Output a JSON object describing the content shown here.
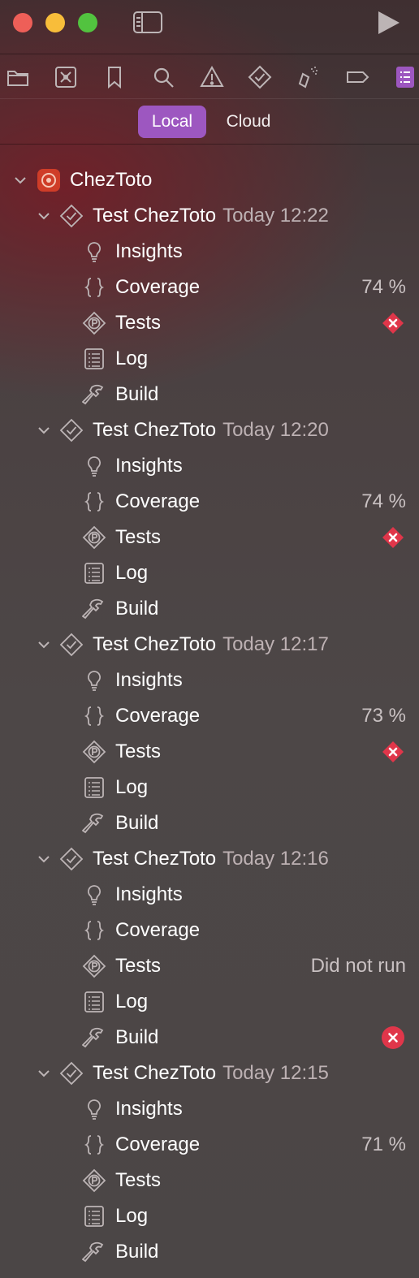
{
  "colors": {
    "accent": "#9d57c0",
    "error": "#e0364a",
    "traffic_close": "#ee5f58",
    "traffic_minimize": "#f8bd3a",
    "traffic_zoom": "#52c33f"
  },
  "titlebar": {
    "icons": [
      "close-button",
      "minimize-button",
      "zoom-button",
      "sidebar-toggle-icon",
      "run-icon"
    ]
  },
  "toolbar": {
    "icons": [
      "folder-icon",
      "source-control-icon",
      "bookmark-icon",
      "search-icon",
      "warning-icon",
      "test-icon",
      "debug-icon",
      "breakpoint-icon",
      "report-icon"
    ],
    "selected": "report-icon"
  },
  "segments": {
    "local": "Local",
    "cloud": "Cloud",
    "selected": "Local"
  },
  "project": {
    "name": "ChezToto"
  },
  "runs": [
    {
      "title": "Test ChezToto",
      "time": "Today 12:22",
      "items": [
        {
          "label": "Insights",
          "icon": "lightbulb-icon",
          "value": ""
        },
        {
          "label": "Coverage",
          "icon": "braces-icon",
          "value": "74 %"
        },
        {
          "label": "Tests",
          "icon": "test-plan-icon",
          "value": "",
          "status": "failed"
        },
        {
          "label": "Log",
          "icon": "log-icon",
          "value": ""
        },
        {
          "label": "Build",
          "icon": "hammer-icon",
          "value": ""
        }
      ]
    },
    {
      "title": "Test ChezToto",
      "time": "Today 12:20",
      "items": [
        {
          "label": "Insights",
          "icon": "lightbulb-icon",
          "value": ""
        },
        {
          "label": "Coverage",
          "icon": "braces-icon",
          "value": "74 %"
        },
        {
          "label": "Tests",
          "icon": "test-plan-icon",
          "value": "",
          "status": "failed"
        },
        {
          "label": "Log",
          "icon": "log-icon",
          "value": ""
        },
        {
          "label": "Build",
          "icon": "hammer-icon",
          "value": ""
        }
      ]
    },
    {
      "title": "Test ChezToto",
      "time": "Today 12:17",
      "items": [
        {
          "label": "Insights",
          "icon": "lightbulb-icon",
          "value": ""
        },
        {
          "label": "Coverage",
          "icon": "braces-icon",
          "value": "73 %"
        },
        {
          "label": "Tests",
          "icon": "test-plan-icon",
          "value": "",
          "status": "failed"
        },
        {
          "label": "Log",
          "icon": "log-icon",
          "value": ""
        },
        {
          "label": "Build",
          "icon": "hammer-icon",
          "value": ""
        }
      ]
    },
    {
      "title": "Test ChezToto",
      "time": "Today 12:16",
      "items": [
        {
          "label": "Insights",
          "icon": "lightbulb-icon",
          "value": ""
        },
        {
          "label": "Coverage",
          "icon": "braces-icon",
          "value": ""
        },
        {
          "label": "Tests",
          "icon": "test-plan-icon",
          "value": "Did not run"
        },
        {
          "label": "Log",
          "icon": "log-icon",
          "value": ""
        },
        {
          "label": "Build",
          "icon": "hammer-icon",
          "value": "",
          "status": "error"
        }
      ]
    },
    {
      "title": "Test ChezToto",
      "time": "Today 12:15",
      "items": [
        {
          "label": "Insights",
          "icon": "lightbulb-icon",
          "value": ""
        },
        {
          "label": "Coverage",
          "icon": "braces-icon",
          "value": "71 %"
        },
        {
          "label": "Tests",
          "icon": "test-plan-icon",
          "value": ""
        },
        {
          "label": "Log",
          "icon": "log-icon",
          "value": ""
        },
        {
          "label": "Build",
          "icon": "hammer-icon",
          "value": ""
        }
      ]
    }
  ]
}
